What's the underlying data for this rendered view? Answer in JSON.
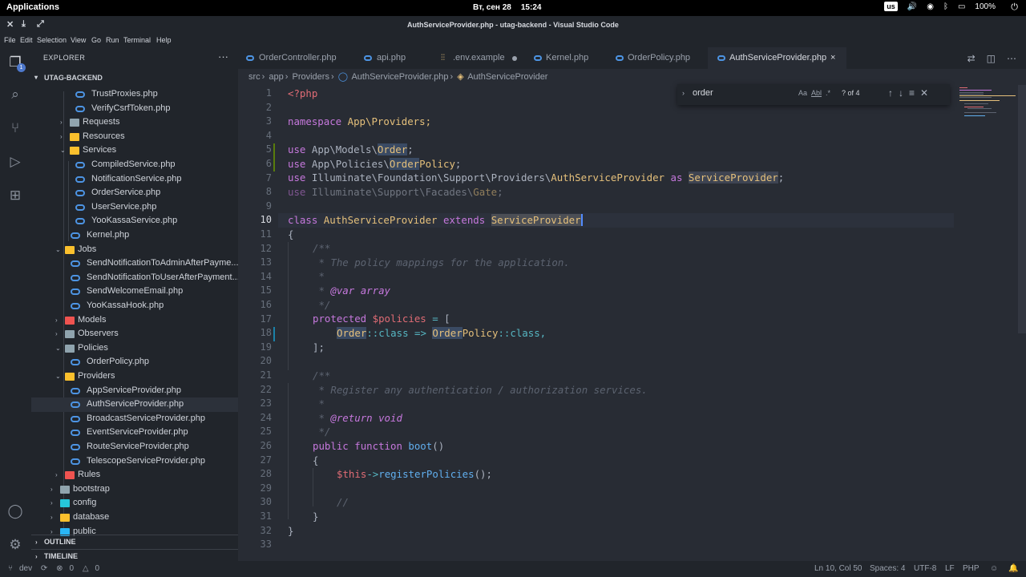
{
  "os": {
    "apps_label": "Applications",
    "date": "Вт, сен 28",
    "time": "15:24",
    "keyboard": "us",
    "battery": "100%"
  },
  "window": {
    "title": "AuthServiceProvider.php - utag-backend - Visual Studio Code"
  },
  "menu": [
    "File",
    "Edit",
    "Selection",
    "View",
    "Go",
    "Run",
    "Terminal",
    "Help"
  ],
  "activity": {
    "badge": "1"
  },
  "explorer": {
    "title": "EXPLORER",
    "more": "···",
    "project": "UTAG-BACKEND",
    "items": [
      {
        "name": "TrustProxies.php",
        "type": "php"
      },
      {
        "name": "VerifyCsrfToken.php",
        "type": "php"
      },
      {
        "name": "Requests",
        "type": "folder"
      },
      {
        "name": "Resources",
        "type": "folder"
      },
      {
        "name": "Services",
        "type": "folder-open"
      },
      {
        "name": "CompiledService.php",
        "type": "php"
      },
      {
        "name": "NotificationService.php",
        "type": "php"
      },
      {
        "name": "OrderService.php",
        "type": "php"
      },
      {
        "name": "UserService.php",
        "type": "php"
      },
      {
        "name": "YooKassaService.php",
        "type": "php"
      },
      {
        "name": "Kernel.php",
        "type": "php"
      },
      {
        "name": "Jobs",
        "type": "folder-open"
      },
      {
        "name": "SendNotificationToAdminAfterPayme...",
        "type": "php"
      },
      {
        "name": "SendNotificationToUserAfterPayment...",
        "type": "php"
      },
      {
        "name": "SendWelcomeEmail.php",
        "type": "php"
      },
      {
        "name": "YooKassaHook.php",
        "type": "php"
      },
      {
        "name": "Models",
        "type": "folder"
      },
      {
        "name": "Observers",
        "type": "folder"
      },
      {
        "name": "Policies",
        "type": "folder-open"
      },
      {
        "name": "OrderPolicy.php",
        "type": "php"
      },
      {
        "name": "Providers",
        "type": "folder-open"
      },
      {
        "name": "AppServiceProvider.php",
        "type": "php"
      },
      {
        "name": "AuthServiceProvider.php",
        "type": "php"
      },
      {
        "name": "BroadcastServiceProvider.php",
        "type": "php"
      },
      {
        "name": "EventServiceProvider.php",
        "type": "php"
      },
      {
        "name": "RouteServiceProvider.php",
        "type": "php"
      },
      {
        "name": "TelescopeServiceProvider.php",
        "type": "php"
      },
      {
        "name": "Rules",
        "type": "folder"
      },
      {
        "name": "bootstrap",
        "type": "folder"
      },
      {
        "name": "config",
        "type": "folder"
      },
      {
        "name": "database",
        "type": "folder"
      },
      {
        "name": "public",
        "type": "folder"
      }
    ],
    "outline": "OUTLINE",
    "timeline": "TIMELINE"
  },
  "tabs": [
    {
      "name": "OrderController.php",
      "icon": "php-icon"
    },
    {
      "name": "api.php",
      "icon": "php-icon"
    },
    {
      "name": ".env.example",
      "icon": "env-icon"
    },
    {
      "name": "Kernel.php",
      "icon": "php-icon"
    },
    {
      "name": "OrderPolicy.php",
      "icon": "php-icon"
    },
    {
      "name": "AuthServiceProvider.php",
      "icon": "php-icon"
    }
  ],
  "env_glyph": "⫶⫶",
  "tab_close": "×",
  "breadcrumb": [
    "src",
    "app",
    "Providers",
    "AuthServiceProvider.php",
    "AuthServiceProvider"
  ],
  "find": {
    "query": "order",
    "case": "Aa",
    "word": "Abl",
    "regex": ".*",
    "result": "? of 4"
  },
  "line_numbers": [
    "1",
    "2",
    "3",
    "4",
    "5",
    "6",
    "7",
    "8",
    "9",
    "10",
    "11",
    "12",
    "13",
    "14",
    "15",
    "16",
    "17",
    "18",
    "19",
    "20",
    "21",
    "22",
    "23",
    "24",
    "25",
    "26",
    "27",
    "28",
    "29",
    "30",
    "31",
    "32",
    "33"
  ],
  "code": {
    "php_tag": "<?php",
    "ns_kw": "namespace",
    "ns": "App\\Providers;",
    "use": "use",
    "l5a": "App\\Models\\",
    "l5b": "Order",
    "l6a": "App\\Policies\\",
    "l6b": "Order",
    "l6c": "Policy",
    "l7a": "Illuminate\\Foundation\\Support\\Providers\\",
    "l7b": "AuthServiceProvider",
    "l7as": "as",
    "l7c": "ServiceProvider",
    "l8a": "Illuminate\\Support\\Facades\\",
    "l8b": "Gate",
    "class_kw": "class",
    "class_name": "AuthServiceProvider",
    "extends_kw": "extends",
    "parent": "ServiceProvider",
    "brace_open": "{",
    "doc_open": "/**",
    "doc1": " * The policy mappings for the application.",
    "doc_star": " *",
    "doc_var_tag": "@var",
    "doc_var_type": "array",
    "doc_close": " */",
    "protected_kw": "protected",
    "policies_var": "$policies",
    "eq": "=",
    "bracket": "[",
    "l18a": "Order",
    "l18b": "::class",
    "l18arrow": "=>",
    "l18c": "Order",
    "l18d": "Policy",
    "l18e": "::class,",
    "l19": "];",
    "doc2": " * Register any authentication / authorization services.",
    "doc_return_tag": "@return",
    "doc_return_type": "void",
    "public_kw": "public",
    "function_kw": "function",
    "boot": "boot",
    "parens": "()",
    "this": "$this",
    "arrow": "->",
    "register": "registerPolicies",
    "call_end": "();",
    "comment": "//",
    "brace_close": "}"
  },
  "status": {
    "branch": "dev",
    "problems": "0",
    "warnings": "0",
    "position": "Ln 10, Col 50",
    "spaces": "Spaces: 4",
    "encoding": "UTF-8",
    "eol": "LF",
    "language": "PHP"
  }
}
